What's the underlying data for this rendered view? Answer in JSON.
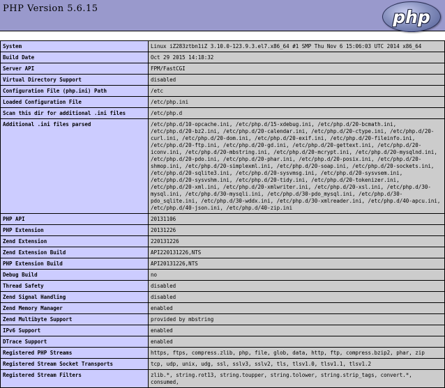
{
  "page": {
    "title": "PHP Version 5.6.15",
    "logo_text": "php"
  },
  "rows": [
    {
      "k": "System",
      "v": "Linux iZ283ztbn1iZ 3.10.0-123.9.3.el7.x86_64 #1 SMP Thu Nov 6 15:06:03 UTC 2014 x86_64"
    },
    {
      "k": "Build Date",
      "v": "Oct 29 2015 14:18:32"
    },
    {
      "k": "Server API",
      "v": "FPM/FastCGI"
    },
    {
      "k": "Virtual Directory Support",
      "v": "disabled"
    },
    {
      "k": "Configuration File (php.ini) Path",
      "v": "/etc"
    },
    {
      "k": "Loaded Configuration File",
      "v": "/etc/php.ini"
    },
    {
      "k": "Scan this dir for additional .ini files",
      "v": "/etc/php.d"
    },
    {
      "k": "Additional .ini files parsed",
      "v": "/etc/php.d/10-opcache.ini, /etc/php.d/15-xdebug.ini, /etc/php.d/20-bcmath.ini, /etc/php.d/20-bz2.ini, /etc/php.d/20-calendar.ini, /etc/php.d/20-ctype.ini, /etc/php.d/20-curl.ini, /etc/php.d/20-dom.ini, /etc/php.d/20-exif.ini, /etc/php.d/20-fileinfo.ini, /etc/php.d/20-ftp.ini, /etc/php.d/20-gd.ini, /etc/php.d/20-gettext.ini, /etc/php.d/20-iconv.ini, /etc/php.d/20-mbstring.ini, /etc/php.d/20-mcrypt.ini, /etc/php.d/20-mysqlnd.ini, /etc/php.d/20-pdo.ini, /etc/php.d/20-phar.ini, /etc/php.d/20-posix.ini, /etc/php.d/20-shmop.ini, /etc/php.d/20-simplexml.ini, /etc/php.d/20-soap.ini, /etc/php.d/20-sockets.ini, /etc/php.d/20-sqlite3.ini, /etc/php.d/20-sysvmsg.ini, /etc/php.d/20-sysvsem.ini, /etc/php.d/20-sysvshm.ini, /etc/php.d/20-tidy.ini, /etc/php.d/20-tokenizer.ini, /etc/php.d/20-xml.ini, /etc/php.d/20-xmlwriter.ini, /etc/php.d/20-xsl.ini, /etc/php.d/30-mysql.ini, /etc/php.d/30-mysqli.ini, /etc/php.d/30-pdo_mysql.ini, /etc/php.d/30-pdo_sqlite.ini, /etc/php.d/30-wddx.ini, /etc/php.d/30-xmlreader.ini, /etc/php.d/40-apcu.ini, /etc/php.d/40-json.ini, /etc/php.d/40-zip.ini"
    },
    {
      "k": "PHP API",
      "v": "20131106"
    },
    {
      "k": "PHP Extension",
      "v": "20131226"
    },
    {
      "k": "Zend Extension",
      "v": "220131226"
    },
    {
      "k": "Zend Extension Build",
      "v": "API220131226,NTS"
    },
    {
      "k": "PHP Extension Build",
      "v": "API20131226,NTS"
    },
    {
      "k": "Debug Build",
      "v": "no"
    },
    {
      "k": "Thread Safety",
      "v": "disabled"
    },
    {
      "k": "Zend Signal Handling",
      "v": "disabled"
    },
    {
      "k": "Zend Memory Manager",
      "v": "enabled"
    },
    {
      "k": "Zend Multibyte Support",
      "v": "provided by mbstring"
    },
    {
      "k": "IPv6 Support",
      "v": "enabled"
    },
    {
      "k": "DTrace Support",
      "v": "enabled"
    },
    {
      "k": "Registered PHP Streams",
      "v": "https, ftps, compress.zlib, php, file, glob, data, http, ftp, compress.bzip2, phar, zip"
    },
    {
      "k": "Registered Stream Socket Transports",
      "v": "tcp, udp, unix, udg, ssl, sslv3, sslv2, tls, tlsv1.0, tlsv1.1, tlsv1.2"
    },
    {
      "k": "Registered Stream Filters",
      "v": "zlib.*, string.rot13, string.toupper, string.tolower, string.strip_tags, convert.*, consumed,"
    }
  ]
}
